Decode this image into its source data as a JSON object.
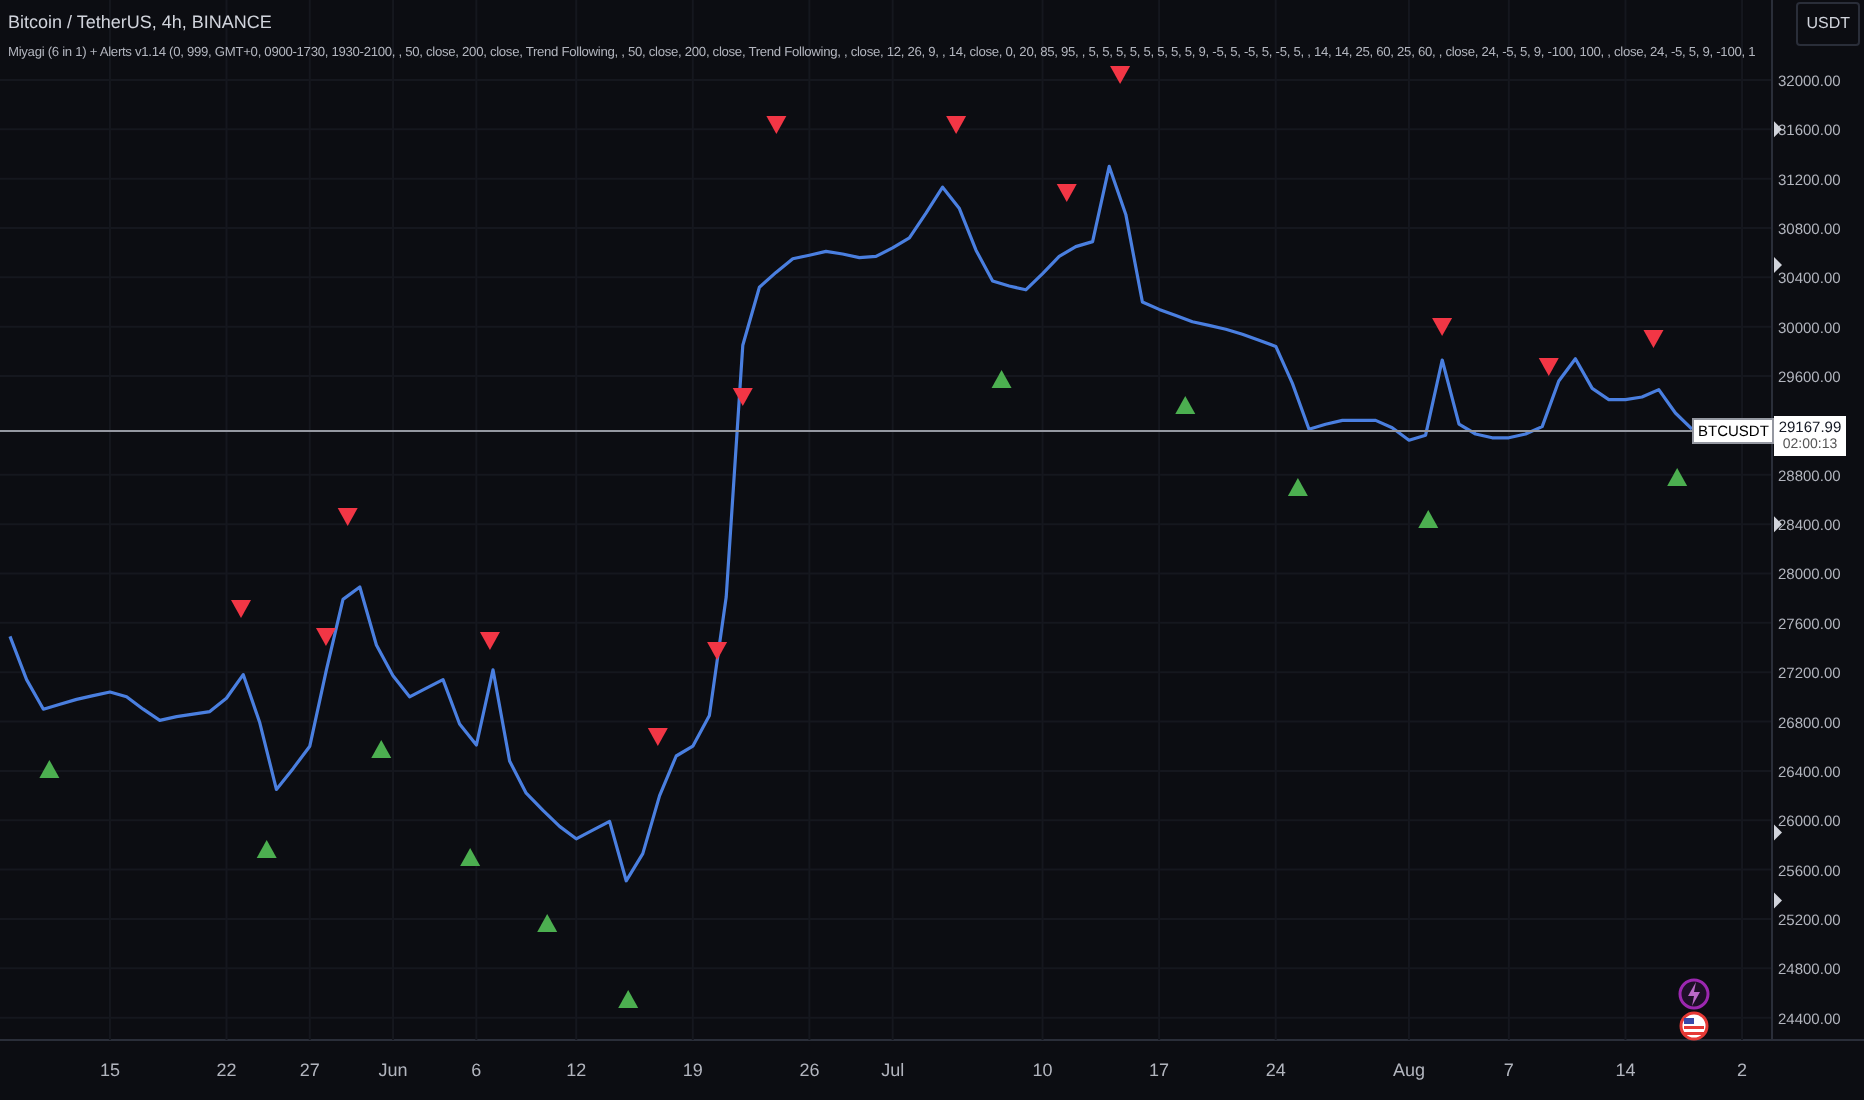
{
  "header": {
    "title": "Bitcoin / TetherUS, 4h, BINANCE",
    "indicator": "Miyagi (6 in 1) + Alerts v1.14 (0, 999, GMT+0, 0900-1730, 1930-2100, , 50, close, 200, close, Trend Following, , 50, close, 200, close, Trend Following, , close, 12, 26, 9, , 14, close, 0, 20, 85, 95, , 5, 5, 5, 5, 5, 5, 5, 5, 9, -5, 5, -5, 5, -5, 5, , 14, 14, 25, 60, 25, 60, , close, 24, -5, 5, 9, -100, 100, , close, 24, -5, 5, 9, -100, 1"
  },
  "currency_button": "USDT",
  "price_line": {
    "label": "29167.99",
    "countdown": "02:00:13"
  },
  "chart_data": {
    "type": "line",
    "grid": true,
    "ylim": [
      24219,
      32648
    ],
    "categories": [
      null,
      null,
      null,
      null,
      null,
      null,
      "15",
      null,
      null,
      null,
      null,
      null,
      null,
      "22",
      null,
      null,
      null,
      null,
      "27",
      null,
      null,
      null,
      null,
      "Jun",
      null,
      null,
      null,
      null,
      "6",
      null,
      null,
      null,
      null,
      null,
      "12",
      null,
      null,
      null,
      null,
      null,
      null,
      "19",
      null,
      null,
      null,
      null,
      null,
      null,
      "26",
      null,
      null,
      null,
      null,
      "Jul",
      null,
      null,
      null,
      null,
      null,
      null,
      null,
      null,
      "10",
      null,
      null,
      null,
      null,
      null,
      null,
      "17",
      null,
      null,
      null,
      null,
      null,
      null,
      "24",
      null,
      null,
      null,
      null,
      null,
      null,
      null,
      "Aug",
      null,
      null,
      null,
      null,
      null,
      "7",
      null,
      null,
      null,
      null,
      null,
      null,
      "14",
      null,
      null,
      null,
      null,
      null,
      null,
      "2",
      null
    ],
    "series": [
      {
        "name": "BTCUSDT",
        "color": "#4a7fe0",
        "values": [
          27490,
          27140,
          26900,
          26940,
          26980,
          27010,
          27040,
          27000,
          26900,
          26810,
          26840,
          26860,
          26880,
          26990,
          27180,
          26790,
          26250,
          26420,
          26600,
          27220,
          27790,
          27890,
          27420,
          27170,
          27000,
          27070,
          27140,
          26780,
          26610,
          27220,
          26480,
          26220,
          26080,
          25950,
          25850,
          25920,
          25990,
          25510,
          25730,
          26200,
          26520,
          26600,
          26850,
          27810,
          29850,
          30320,
          30440,
          30550,
          30580,
          30610,
          30590,
          30560,
          30570,
          30640,
          30720,
          30920,
          31130,
          30960,
          30620,
          30370,
          30330,
          30300,
          30430,
          30570,
          30650,
          30690,
          31300,
          30910,
          30200,
          30140,
          30090,
          30040,
          30010,
          29980,
          29940,
          29890,
          29840,
          29540,
          29170,
          29210,
          29240,
          29240,
          29240,
          29180,
          29080,
          29120,
          29730,
          29210,
          29130,
          29100,
          29100,
          29130,
          29190,
          29560,
          29740,
          29500,
          29410,
          29410,
          29430,
          29490,
          29300,
          29170,
          null,
          null,
          null,
          null
        ]
      }
    ],
    "yticks": [
      {
        "value": 32000,
        "label": "32000.00"
      },
      {
        "value": 31600,
        "label": "31600.00"
      },
      {
        "value": 31200,
        "label": "31200.00"
      },
      {
        "value": 30800,
        "label": "30800.00"
      },
      {
        "value": 30400,
        "label": "30400.00"
      },
      {
        "value": 30000,
        "label": "30000.00"
      },
      {
        "value": 29600,
        "label": "29600.00"
      },
      {
        "value": 28800,
        "label": "28800.00"
      },
      {
        "value": 28400,
        "label": "28400.00"
      },
      {
        "value": 28000,
        "label": "28000.00"
      },
      {
        "value": 27600,
        "label": "27600.00"
      },
      {
        "value": 27200,
        "label": "27200.00"
      },
      {
        "value": 26800,
        "label": "26800.00"
      },
      {
        "value": 26400,
        "label": "26400.00"
      },
      {
        "value": 26000,
        "label": "26000.00"
      },
      {
        "value": 25600,
        "label": "25600.00"
      },
      {
        "value": 25200,
        "label": "25200.00"
      },
      {
        "value": 24800,
        "label": "24800.00"
      },
      {
        "value": 24400,
        "label": "24400.00"
      }
    ]
  }
}
